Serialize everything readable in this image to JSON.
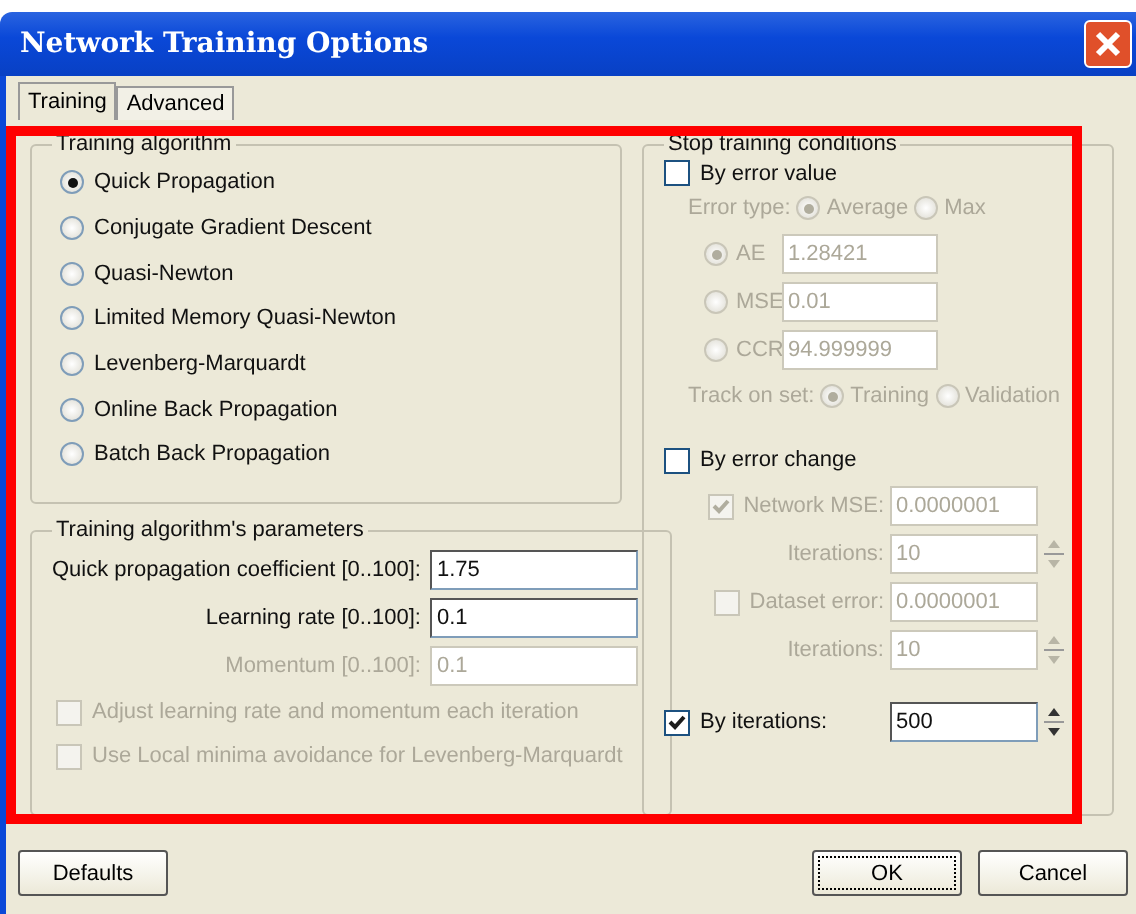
{
  "window": {
    "title": "Network Training Options"
  },
  "tabs": [
    {
      "label": "Training",
      "selected": true
    },
    {
      "label": "Advanced",
      "selected": false
    }
  ],
  "training_algorithm": {
    "title": "Training algorithm",
    "options": [
      {
        "label": "Quick Propagation",
        "selected": true
      },
      {
        "label": "Conjugate Gradient Descent",
        "selected": false
      },
      {
        "label": "Quasi-Newton",
        "selected": false
      },
      {
        "label": "Limited Memory Quasi-Newton",
        "selected": false
      },
      {
        "label": "Levenberg-Marquardt",
        "selected": false
      },
      {
        "label": "Online Back Propagation",
        "selected": false
      },
      {
        "label": "Batch Back Propagation",
        "selected": false
      }
    ]
  },
  "parameters": {
    "title": "Training algorithm's parameters",
    "fields": [
      {
        "label": "Quick propagation coefficient [0..100]:",
        "value": "1.75",
        "disabled": false
      },
      {
        "label": "Learning rate [0..100]:",
        "value": "0.1",
        "disabled": false
      },
      {
        "label": "Momentum [0..100]:",
        "value": "0.1",
        "disabled": true
      }
    ],
    "checkboxes": [
      {
        "label": "Adjust learning rate and momentum each iteration",
        "checked": false,
        "disabled": true
      },
      {
        "label": "Use Local minima avoidance for Levenberg-Marquardt",
        "checked": false,
        "disabled": true
      }
    ]
  },
  "stop_conditions": {
    "title": "Stop training conditions",
    "by_error_value": {
      "label": "By error value",
      "checked": false
    },
    "error_type": {
      "label": "Error type:",
      "options": [
        {
          "label": "Average",
          "selected": true
        },
        {
          "label": "Max",
          "selected": false
        }
      ]
    },
    "error_measures": [
      {
        "label": "AE",
        "value": "1.28421",
        "selected": true
      },
      {
        "label": "MSE",
        "value": "0.01",
        "selected": false
      },
      {
        "label": "CCR",
        "value": "94.999999",
        "selected": false
      }
    ],
    "track_on_set": {
      "label": "Track on set:",
      "options": [
        {
          "label": "Training",
          "selected": true
        },
        {
          "label": "Validation",
          "selected": false
        }
      ]
    },
    "by_error_change": {
      "label": "By error change",
      "checked": false
    },
    "change_rows": [
      {
        "kind": "checkbox",
        "label": "Network MSE:",
        "checked": true,
        "value": "0.0000001"
      },
      {
        "kind": "spin",
        "label": "Iterations:",
        "value": "10"
      },
      {
        "kind": "checkbox",
        "label": "Dataset error:",
        "checked": false,
        "value": "0.0000001"
      },
      {
        "kind": "spin",
        "label": "Iterations:",
        "value": "10"
      }
    ],
    "by_iterations": {
      "label": "By iterations:",
      "checked": true,
      "value": "500"
    }
  },
  "buttons": [
    {
      "label": "Defaults",
      "focused": false
    },
    {
      "label": "OK",
      "focused": true
    },
    {
      "label": "Cancel",
      "focused": false
    }
  ]
}
